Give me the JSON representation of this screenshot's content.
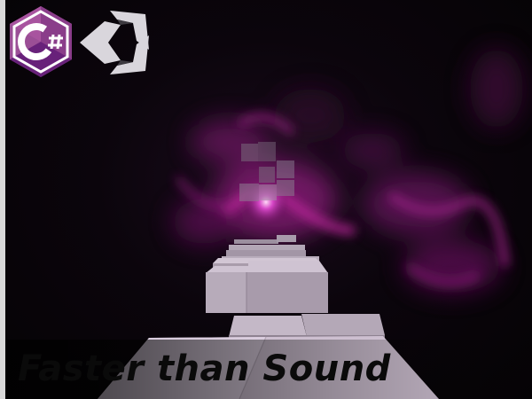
{
  "game": {
    "title": "Faster than Sound"
  },
  "logos": {
    "language": {
      "icon": "csharp-logo-icon",
      "glyph": "C#",
      "color": "#9b4f96"
    },
    "engine": {
      "icon": "unity-logo-icon",
      "color": "#d9d6dc"
    }
  },
  "palette": {
    "background": "#050305",
    "nebula": "#b0208f",
    "platform": "#c8bccb"
  }
}
